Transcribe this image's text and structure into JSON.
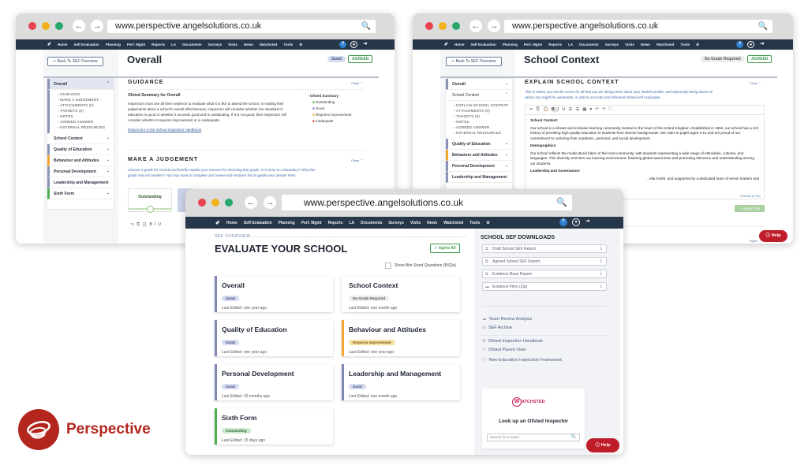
{
  "browser": {
    "url": "www.perspective.angelsolutions.co.uk",
    "back_icon": "arrow-left",
    "forward_icon": "arrow-right"
  },
  "nav": {
    "items": [
      "Home",
      "Self Evaluation",
      "Planning",
      "Perf. Mgmt",
      "Reports",
      "LA",
      "Documents",
      "Surveys",
      "Visits",
      "News",
      "Watchsted",
      "Tools",
      "⚙"
    ]
  },
  "win_overall": {
    "back_label": "⇐ Back To SEF Overview",
    "title": "Overall",
    "grade": "Good",
    "agreed": "AGREED",
    "sidebar": {
      "active": "Overall",
      "sub_items": [
        "GUIDANCE",
        "MAKE A JUDGEMENT",
        "ATTACHMENTS (0)",
        "TARGETS (0)",
        "NOTES",
        "AGREED ANSWER",
        "EXTERNAL RESOURCES"
      ],
      "items": [
        "School Context",
        "Quality of Education",
        "Behaviour and Attitudes",
        "Personal Development",
        "Leadership and Management",
        "Sixth Form"
      ]
    },
    "guidance": {
      "title": "GUIDANCE",
      "close": "Close",
      "summary_title": "Ofsted Summary for Overall",
      "text": "Inspectors must use all their evidence to evaluate what it is like to attend the school. In making their judgements about a school's overall effectiveness, inspectors will consider whether the standard of education is good or whether it exceeds good and is outstanding. If it is not good, then inspectors will consider whether it requires improvement or is inadequate.",
      "link": "Read more in the School Inspection Handbook",
      "legend_title": "Ofsted Summary",
      "legend": [
        {
          "label": "Outstanding",
          "color": "#4caf50"
        },
        {
          "label": "Good",
          "color": "#6b7bb5"
        },
        {
          "label": "Requires Improvement",
          "color": "#f2a531"
        },
        {
          "label": "Inadequate",
          "color": "#d9383a"
        }
      ]
    },
    "judgement": {
      "title": "MAKE A JUDGEMENT",
      "close": "Close",
      "text": "Choose a grade for Overall and briefly explain your reasons for choosing that grade. Is it close to a boundary? Why this grade and not another? You may want to complete and review sub-sections first to guide your answer here.",
      "option": "Outstanding",
      "toolbar": [
        "✂",
        "⎘",
        "📋",
        "B",
        "I",
        "U"
      ]
    }
  },
  "win_context": {
    "back_label": "⇐ Back To SEF Overview",
    "title": "School Context",
    "grade": "No Grade Required",
    "agreed": "AGREED",
    "sidebar": {
      "items_top": [
        "Overall"
      ],
      "active": "School Context",
      "sub_items": [
        "EXPLAIN SCHOOL CONTEXT",
        "ATTACHMENTS (0)",
        "TARGETS (0)",
        "NOTES",
        "AGREED ANSWER",
        "EXTERNAL RESOURCES"
      ],
      "items": [
        "Quality of Education",
        "Behaviour and Attitudes",
        "Personal Development",
        "Leadership and Management"
      ]
    },
    "section_title": "EXPLAIN SCHOOL CONTEXT",
    "close": "Close",
    "intro": "This is where you set the scene for all that you do. Being clear about your student profile, and especially being aware of where any might be vulnerable, is vital to accurate and informed school self evaluation.",
    "editor": {
      "toolbar": [
        "✂",
        "⎘",
        "📋",
        "B",
        "I",
        "U",
        "☰",
        "☰",
        "▦▾",
        "↶",
        "↷",
        "⛶"
      ],
      "h1": "School Context:",
      "p1": "Our school is a vibrant and inclusive learning community located in the heart of the United Kingdom. Established in 1994, our school has a rich history of providing high-quality education to students from diverse backgrounds. We cater to pupils aged 4-11 and are proud of our commitment to nurturing their academic, personal, and social development.",
      "h2": "Demographics:",
      "p2": "Our school reflects the multicultural fabric of the local community, with students representing a wide range of ethnicities, cultures, and languages. This diversity enriches our learning environment, fostering global awareness and promoting tolerance and understanding among our students.",
      "h3": "Leadership and Governance:",
      "p3": "...ella Smith, and supported by a dedicated team of senior leaders and",
      "powered": "Powered by Tiny"
    },
    "agree_text": "✓ Agree Text",
    "open": "Open",
    "help": "Help"
  },
  "win_main": {
    "breadcrumb": "SEF OVERVIEW",
    "title": "EVALUATE YOUR SCHOOL",
    "agree_all": "✓ Agree All",
    "bsq_label": "Show Bite Sized Questions (BSQs)",
    "cards": [
      {
        "title": "Overall",
        "grade": "Good",
        "edited_label": "Last Edited:",
        "edited": "one year ago",
        "color": "#7e88b0",
        "badge_bg": "#d6dbf0",
        "badge_fg": "#3c4a7a"
      },
      {
        "title": "School Context",
        "grade": "No Grade Required",
        "edited_label": "Last Edited:",
        "edited": "one month ago",
        "color": "#ffffff",
        "badge_bg": "#ececec",
        "badge_fg": "#555555"
      },
      {
        "title": "Quality of Education",
        "grade": "Good",
        "edited_label": "Last Edited:",
        "edited": "one year ago",
        "color": "#7e88b0",
        "badge_bg": "#d6dbf0",
        "badge_fg": "#3c4a7a"
      },
      {
        "title": "Behaviour and Attitudes",
        "grade": "Requires Improvement",
        "edited_label": "Last Edited:",
        "edited": "one year ago",
        "color": "#f2a531",
        "badge_bg": "#fbe0a8",
        "badge_fg": "#7a5a10"
      },
      {
        "title": "Personal Development",
        "grade": "Good",
        "edited_label": "Last Edited:",
        "edited": "10 months ago",
        "color": "#7e88b0",
        "badge_bg": "#d6dbf0",
        "badge_fg": "#3c4a7a"
      },
      {
        "title": "Leadership and Management",
        "grade": "Good",
        "edited_label": "Last Edited:",
        "edited": "one month ago",
        "color": "#7e88b0",
        "badge_bg": "#d6dbf0",
        "badge_fg": "#3c4a7a"
      },
      {
        "title": "Sixth Form",
        "grade": "Outstanding",
        "edited_label": "Last Edited:",
        "edited": "15 days ago",
        "color": "#4caf50",
        "badge_bg": "#cfe8cf",
        "badge_fg": "#2d6a2d"
      }
    ],
    "downloads_title": "SCHOOL SEF DOWNLOADS",
    "downloads": [
      {
        "label": "Draft School SEF Report",
        "icon": "copy-icon"
      },
      {
        "label": "Agreed School SEF Report",
        "icon": "copy-icon"
      },
      {
        "label": "Evidence Base Report",
        "icon": "copy-icon"
      },
      {
        "label": "Evidence Files (Zip)",
        "icon": "folder-icon"
      }
    ],
    "links_a": [
      {
        "label": "Team Review Analysis",
        "icon": "☁"
      },
      {
        "label": "SEF Archive",
        "icon": "◷"
      }
    ],
    "links_b": [
      {
        "label": "Ofsted Inspection Handbook",
        "icon": "✲"
      },
      {
        "label": "Ofsted Parent View",
        "icon": "⚇"
      },
      {
        "label": "New Education Inspection Framework",
        "icon": "ⓘ"
      }
    ],
    "watchsted": {
      "logo_w": "W",
      "logo_rest": "ATCHSTED",
      "title": "Look up an Ofsted Inspector",
      "placeholder": "Search for a name"
    },
    "help": "Help"
  },
  "brand": {
    "name": "Perspective",
    "color": "#b3261e"
  }
}
